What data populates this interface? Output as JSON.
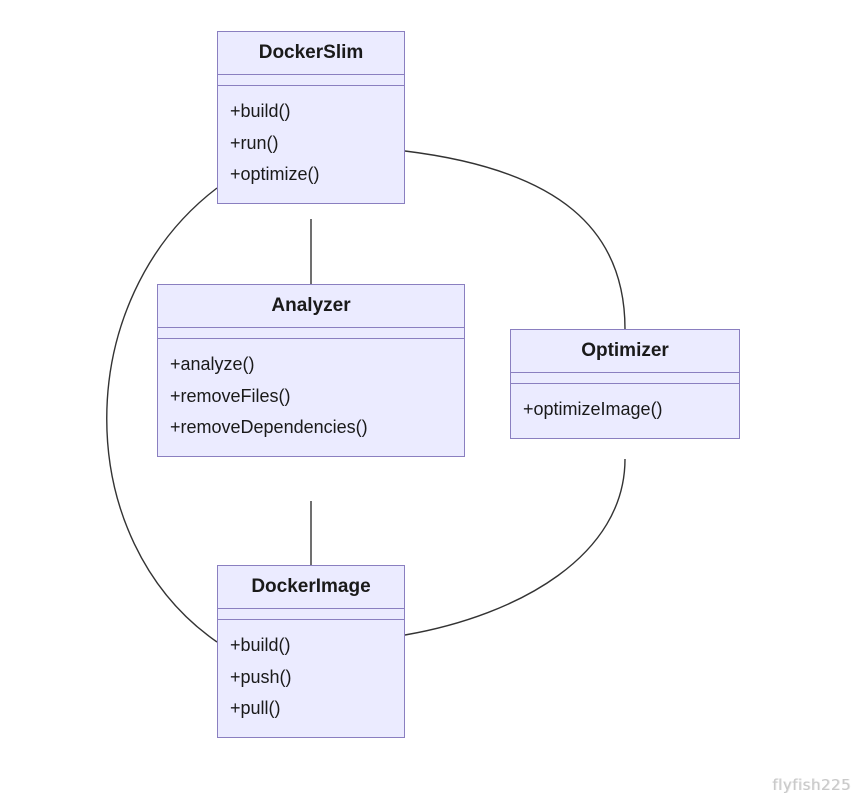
{
  "classes": {
    "dockerSlim": {
      "title": "DockerSlim",
      "methods": [
        "+build()",
        "+run()",
        "+optimize()"
      ]
    },
    "analyzer": {
      "title": "Analyzer",
      "methods": [
        "+analyze()",
        "+removeFiles()",
        "+removeDependencies()"
      ]
    },
    "optimizer": {
      "title": "Optimizer",
      "methods": [
        "+optimizeImage()"
      ]
    },
    "dockerImage": {
      "title": "DockerImage",
      "methods": [
        "+build()",
        "+push()",
        "+pull()"
      ]
    }
  },
  "watermark": "flyfish225"
}
